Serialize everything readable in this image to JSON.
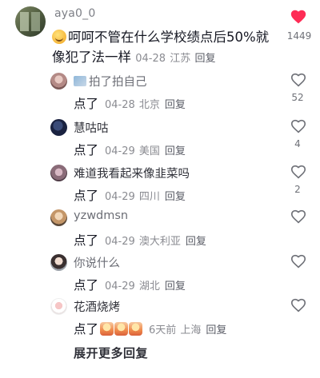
{
  "comment": {
    "username": "aya0_0",
    "text": "呵呵不管在什么学校绩点后50%就像犯了法一样",
    "date": "04-28",
    "location": "江苏",
    "reply_label": "回复",
    "like_count": "1449",
    "liked": true,
    "like_color": "#fe2c55"
  },
  "replies": [
    {
      "name": "拍了拍自己",
      "text": "点了",
      "date": "04-28",
      "location": "北京",
      "reply_label": "回复",
      "like_count": "52"
    },
    {
      "name": "慧咕咕",
      "text": "点了",
      "date": "04-29",
      "location": "美国",
      "reply_label": "回复",
      "like_count": "4"
    },
    {
      "name": "难道我看起来像韭菜吗",
      "text": "点了",
      "date": "04-29",
      "location": "四川",
      "reply_label": "回复",
      "like_count": "2"
    },
    {
      "name": "yzwdmsn",
      "text": "点了",
      "date": "04-29",
      "location": "澳大利亚",
      "reply_label": "回复",
      "like_count": ""
    },
    {
      "name": "你说什么",
      "text": "点了",
      "date": "04-29",
      "location": "湖北",
      "reply_label": "回复",
      "like_count": ""
    },
    {
      "name": "花酒烧烤",
      "text": "点了",
      "date": "6天前",
      "location": "上海",
      "reply_label": "回复",
      "like_count": ""
    }
  ],
  "expand_label": "展开更多回复",
  "icons": {
    "like": "heart-outline-icon",
    "liked": "heart-filled-icon"
  }
}
